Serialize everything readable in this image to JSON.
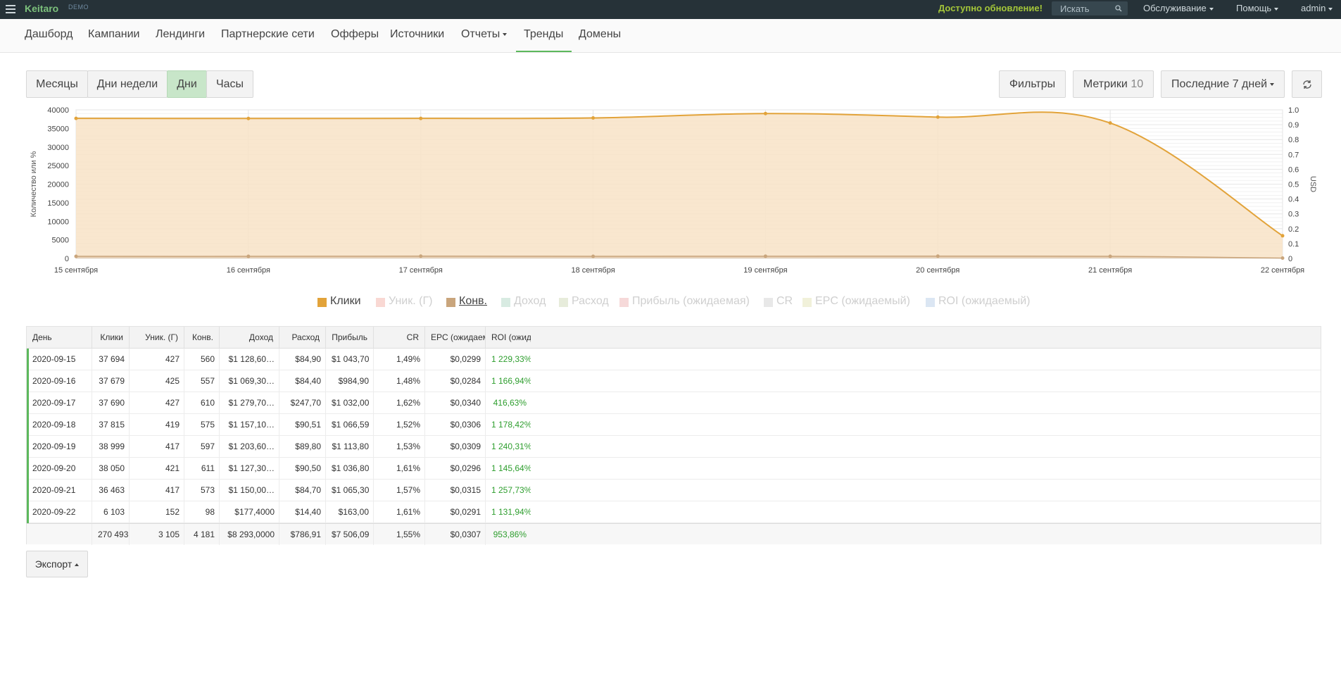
{
  "topbar": {
    "brand": "Keitaro",
    "demo": "DEMO",
    "update": "Доступно обновление!",
    "search_placeholder": "Искать",
    "menus": [
      "Обслуживание",
      "Помощь",
      "admin"
    ]
  },
  "nav": {
    "items": [
      "Дашборд",
      "Кампании",
      "Лендинги",
      "Партнерские сети",
      "Офферы",
      "Источники",
      "Отчеты",
      "Тренды",
      "Домены"
    ],
    "active": "Тренды"
  },
  "controls": {
    "periods": [
      "Месяцы",
      "Дни недели",
      "Дни",
      "Часы"
    ],
    "active_period": "Дни",
    "filters": "Фильтры",
    "metrics": "Метрики",
    "metrics_count": "10",
    "range": "Последние 7 дней"
  },
  "chart_data": {
    "type": "area",
    "title": "",
    "x": [
      "15 сентября",
      "16 сентября",
      "17 сентября",
      "18 сентября",
      "19 сентября",
      "20 сентября",
      "21 сентября",
      "22 сентября"
    ],
    "ylabel": "Количество или %",
    "y2label": "USD",
    "ylim": [
      0,
      40000
    ],
    "y2lim": [
      0,
      1.0
    ],
    "yticks": [
      "40000",
      "35000",
      "30000",
      "25000",
      "20000",
      "15000",
      "10000",
      "5000",
      "0"
    ],
    "y2ticks": [
      "1.0",
      "0.9",
      "0.8",
      "0.7",
      "0.6",
      "0.5",
      "0.4",
      "0.3",
      "0.2",
      "0.1",
      "0"
    ],
    "grid": true,
    "series": [
      {
        "name": "Клики",
        "color": "#e2a33a",
        "values": [
          37694,
          37679,
          37690,
          37815,
          38999,
          38050,
          36463,
          6103
        ]
      },
      {
        "name": "Конв.",
        "color": "#c9a57c",
        "values": [
          560,
          557,
          610,
          575,
          597,
          611,
          573,
          98
        ]
      }
    ]
  },
  "legend": [
    {
      "label": "Клики",
      "color": "#e2a33a",
      "active": true
    },
    {
      "label": "Уник. (Г)",
      "color": "#f9d8d3",
      "active": false
    },
    {
      "label": "Конв.",
      "color": "#c9a57c",
      "active": true
    },
    {
      "label": "Доход",
      "color": "#d8ebe2",
      "active": false
    },
    {
      "label": "Расход",
      "color": "#e7ecdb",
      "active": false
    },
    {
      "label": "Прибыль (ожидаемая)",
      "color": "#f6d9d9",
      "active": false
    },
    {
      "label": "CR",
      "color": "#e8e8e8",
      "active": false
    },
    {
      "label": "EPC (ожидаемый)",
      "color": "#f1f1da",
      "active": false
    },
    {
      "label": "ROI (ожидаемый)",
      "color": "#dbe6f3",
      "active": false
    }
  ],
  "table": {
    "headers": [
      "День",
      "Клики",
      "Уник. (Г)",
      "Конв.",
      "Доход",
      "Расход",
      "Прибыль",
      "CR",
      "EPC (ожидаемый)",
      "ROI (ожидаемый)"
    ],
    "rows": [
      [
        "2020-09-15",
        "37 694",
        "427",
        "560",
        "$1 128,60…",
        "$84,90",
        "$1 043,70",
        "1,49%",
        "$0,0299",
        "1 229,33%"
      ],
      [
        "2020-09-16",
        "37 679",
        "425",
        "557",
        "$1 069,30…",
        "$84,40",
        "$984,90",
        "1,48%",
        "$0,0284",
        "1 166,94%"
      ],
      [
        "2020-09-17",
        "37 690",
        "427",
        "610",
        "$1 279,70…",
        "$247,70",
        "$1 032,00",
        "1,62%",
        "$0,0340",
        "416,63%"
      ],
      [
        "2020-09-18",
        "37 815",
        "419",
        "575",
        "$1 157,10…",
        "$90,51",
        "$1 066,59",
        "1,52%",
        "$0,0306",
        "1 178,42%"
      ],
      [
        "2020-09-19",
        "38 999",
        "417",
        "597",
        "$1 203,60…",
        "$89,80",
        "$1 113,80",
        "1,53%",
        "$0,0309",
        "1 240,31%"
      ],
      [
        "2020-09-20",
        "38 050",
        "421",
        "611",
        "$1 127,30…",
        "$90,50",
        "$1 036,80",
        "1,61%",
        "$0,0296",
        "1 145,64%"
      ],
      [
        "2020-09-21",
        "36 463",
        "417",
        "573",
        "$1 150,00…",
        "$84,70",
        "$1 065,30",
        "1,57%",
        "$0,0315",
        "1 257,73%"
      ],
      [
        "2020-09-22",
        "6 103",
        "152",
        "98",
        "$177,4000",
        "$14,40",
        "$163,00",
        "1,61%",
        "$0,0291",
        "1 131,94%"
      ]
    ],
    "totals": [
      "",
      "270 493",
      "3 105",
      "4 181",
      "$8 293,0000",
      "$786,91",
      "$7 506,09",
      "1,55%",
      "$0,0307",
      "953,86%"
    ]
  },
  "export": "Экспорт"
}
